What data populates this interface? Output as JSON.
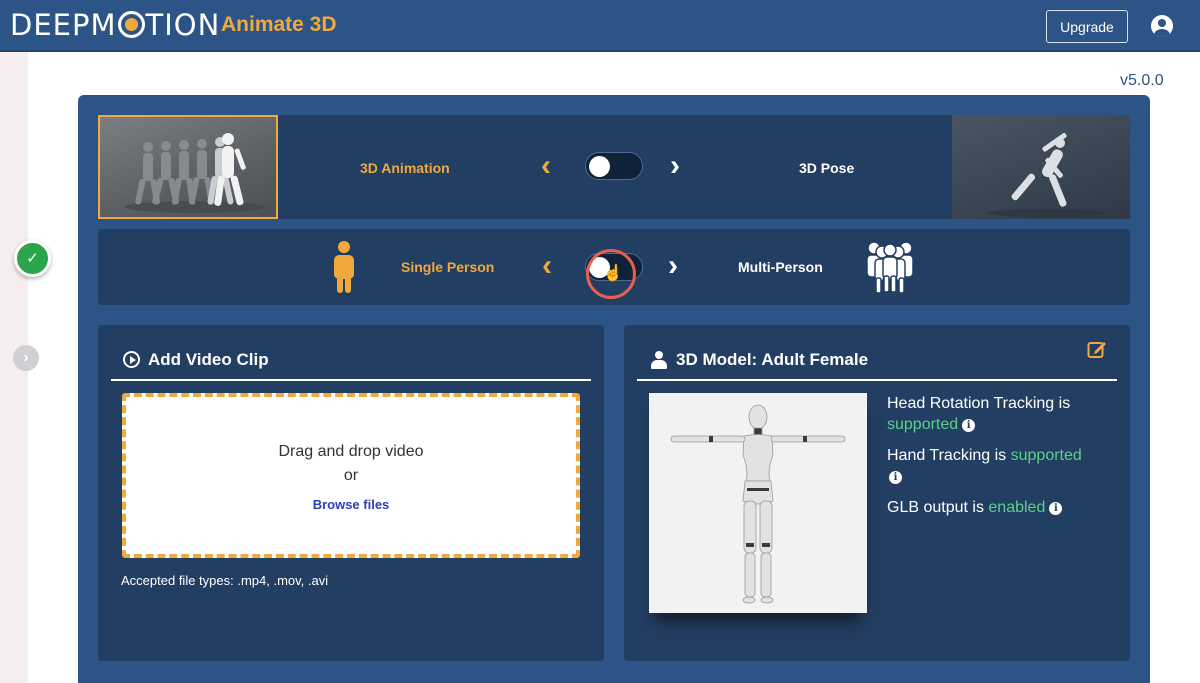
{
  "header": {
    "logo_text": "DEEPMOTION",
    "app_name": "Animate 3D",
    "upgrade_label": "Upgrade"
  },
  "version": "v5.0.0",
  "mode_toggle": {
    "left_label": "3D Animation",
    "right_label": "3D Pose",
    "state": "left"
  },
  "person_toggle": {
    "left_label": "Single Person",
    "right_label": "Multi-Person",
    "state": "left"
  },
  "video_card": {
    "title": "Add Video Clip",
    "drop_line1": "Drag and drop video",
    "drop_line2": "or",
    "browse_label": "Browse files",
    "accepted_types": "Accepted file types: .mp4, .mov, .avi"
  },
  "model_card": {
    "title": "3D Model:  Adult Female",
    "features": [
      {
        "prefix": "Head Rotation Tracking is",
        "status": "supported"
      },
      {
        "prefix": "Hand Tracking is",
        "status": "supported"
      },
      {
        "prefix": "GLB output is",
        "status": "enabled"
      }
    ]
  },
  "colors": {
    "header_bg": "#2d5486",
    "panel_bg": "#2d5486",
    "row_bg": "#233e63",
    "accent": "#f0a93c",
    "status_green": "#5cd08a",
    "step_done": "#2aa54b"
  },
  "icons": [
    "user-circle-icon",
    "check-icon",
    "chevron-right-icon",
    "play-circle-icon",
    "user-icon",
    "edit-icon",
    "info-icon",
    "single-person-icon",
    "multi-person-icon",
    "hand-cursor-icon"
  ]
}
